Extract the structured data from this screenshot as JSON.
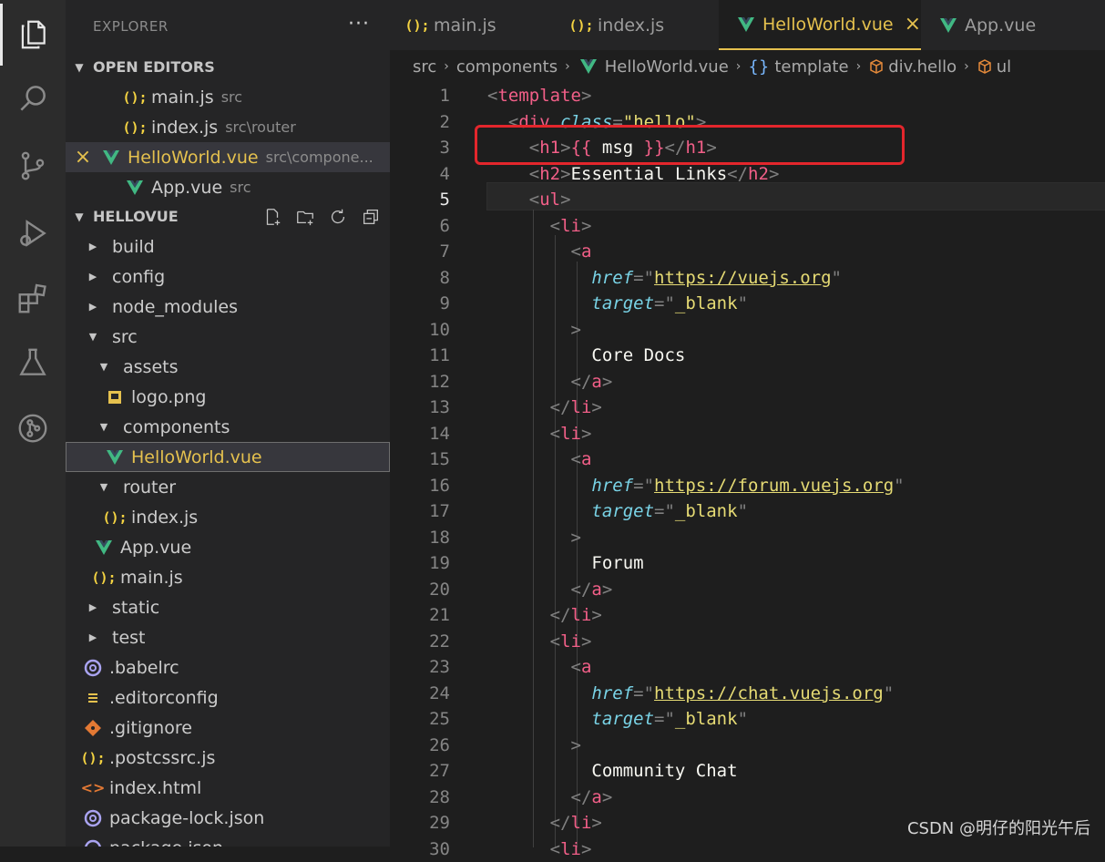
{
  "sidebar": {
    "explorer_title": "EXPLORER",
    "more_label": "···",
    "open_editors_label": "OPEN EDITORS",
    "open_editors": [
      {
        "name": "main.js",
        "path": "src",
        "icon": "js-icon"
      },
      {
        "name": "index.js",
        "path": "src\\router",
        "icon": "js-icon"
      },
      {
        "name": "HelloWorld.vue",
        "path": "src\\compone...",
        "icon": "vue-icon",
        "modified": true
      },
      {
        "name": "App.vue",
        "path": "src",
        "icon": "vue-icon"
      }
    ],
    "project_label": "HELLOVUE",
    "tree": [
      {
        "name": "build"
      },
      {
        "name": "config"
      },
      {
        "name": "node_modules"
      },
      {
        "name": "src"
      },
      {
        "name": "assets"
      },
      {
        "name": "logo.png"
      },
      {
        "name": "components"
      },
      {
        "name": "HelloWorld.vue"
      },
      {
        "name": "router"
      },
      {
        "name": "index.js"
      },
      {
        "name": "App.vue"
      },
      {
        "name": "main.js"
      },
      {
        "name": "static"
      },
      {
        "name": "test"
      },
      {
        "name": ".babelrc"
      },
      {
        "name": ".editorconfig"
      },
      {
        "name": ".gitignore"
      },
      {
        "name": ".postcssrc.js"
      },
      {
        "name": "index.html"
      },
      {
        "name": "package-lock.json"
      },
      {
        "name": "package.json"
      }
    ],
    "modified_mark": "×"
  },
  "tabs": [
    {
      "label": "main.js",
      "icon": "js-icon"
    },
    {
      "label": "index.js",
      "icon": "js-icon"
    },
    {
      "label": "HelloWorld.vue",
      "icon": "vue-icon",
      "active": true,
      "close": "×"
    },
    {
      "label": "App.vue",
      "icon": "vue-icon"
    }
  ],
  "js_glyph": "();",
  "breadcrumb": {
    "items": [
      "src",
      "components",
      "HelloWorld.vue",
      "template",
      "div.hello",
      "ul"
    ],
    "sep": "›",
    "braces": "{}"
  },
  "editor": {
    "current_line": 5,
    "line_numbers": [
      "1",
      "2",
      "3",
      "4",
      "5",
      "6",
      "7",
      "8",
      "9",
      "10",
      "11",
      "12",
      "13",
      "14",
      "15",
      "16",
      "17",
      "18",
      "19",
      "20",
      "21",
      "22",
      "23",
      "24",
      "25",
      "26",
      "27",
      "28",
      "29",
      "30"
    ],
    "code": [
      "<template>",
      "  <div class=\"hello\">",
      "    <h1>{{ msg }}</h1>",
      "    <h2>Essential Links</h2>",
      "    <ul>",
      "      <li>",
      "        <a",
      "          href=\"https://vuejs.org\"",
      "          target=\"_blank\"",
      "        >",
      "          Core Docs",
      "        </a>",
      "      </li>",
      "      <li>",
      "        <a",
      "          href=\"https://forum.vuejs.org\"",
      "          target=\"_blank\"",
      "        >",
      "          Forum",
      "        </a>",
      "      </li>",
      "      <li>",
      "        <a",
      "          href=\"https://chat.vuejs.org\"",
      "          target=\"_blank\"",
      "        >",
      "          Community Chat",
      "        </a>",
      "      </li>",
      "      <li>"
    ]
  },
  "watermark": "CSDN @明仔的阳光午后",
  "colors": {
    "accent": "#e5c14e",
    "tag": "#f25f88",
    "attr": "#79d3e6",
    "string": "#e6db74",
    "highlight_box": "#e3262c"
  }
}
